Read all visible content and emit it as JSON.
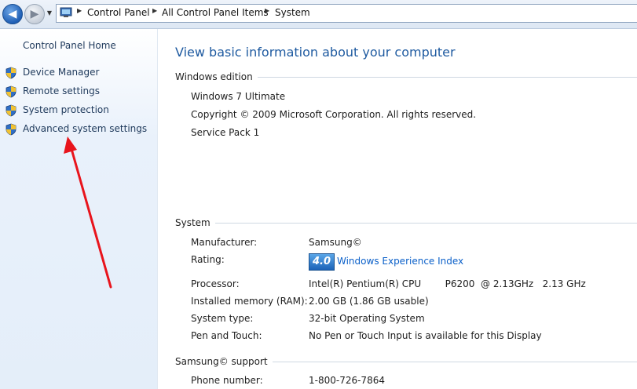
{
  "breadcrumb": {
    "items": [
      "Control Panel",
      "All Control Panel Items",
      "System"
    ],
    "separator": "▶"
  },
  "nav": {
    "back_label": "◀",
    "forward_label": "▶",
    "history_label": "▼"
  },
  "sidebar": {
    "home": "Control Panel Home",
    "tasks": [
      {
        "label": "Device Manager",
        "icon": "shield-icon"
      },
      {
        "label": "Remote settings",
        "icon": "shield-icon"
      },
      {
        "label": "System protection",
        "icon": "shield-icon"
      },
      {
        "label": "Advanced system settings",
        "icon": "shield-icon"
      }
    ]
  },
  "main": {
    "title": "View basic information about your computer",
    "windows_edition": {
      "header": "Windows edition",
      "edition": "Windows 7 Ultimate",
      "copyright": "Copyright © 2009 Microsoft Corporation.  All rights reserved.",
      "service_pack": "Service Pack 1"
    },
    "system": {
      "header": "System",
      "manufacturer_label": "Manufacturer:",
      "manufacturer": "Samsung©",
      "rating_label": "Rating:",
      "rating_score": "4.0",
      "rating_link": "Windows Experience Index",
      "processor_label": "Processor:",
      "processor": "Intel(R) Pentium(R) CPU        P6200  @ 2.13GHz   2.13 GHz",
      "memory_label": "Installed memory (RAM):",
      "memory": "2.00 GB (1.86 GB usable)",
      "type_label": "System type:",
      "type": "32-bit Operating System",
      "pen_label": "Pen and Touch:",
      "pen": "No Pen or Touch Input is available for this Display"
    },
    "support": {
      "header": "Samsung© support",
      "phone_label": "Phone number:",
      "phone": "1-800-726-7864"
    }
  },
  "colors": {
    "title_blue": "#1e5aa0",
    "link_blue": "#0b60c9",
    "annotation_arrow": "#e8141c"
  }
}
